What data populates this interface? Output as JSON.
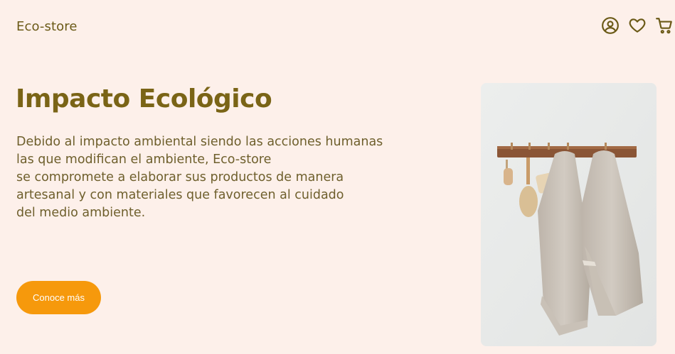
{
  "header": {
    "brand": "Eco-store",
    "icons": [
      "user-icon",
      "heart-icon",
      "cart-icon"
    ]
  },
  "hero": {
    "title": "Impacto Ecológico",
    "description_lines": [
      "Debido al impacto ambiental siendo las acciones humanas",
      "las que modifican el ambiente, Eco-store",
      "se compromete a elaborar sus productos de manera",
      "artesanal y con materiales que favorecen al cuidado",
      "del medio ambiente."
    ],
    "cta_label": "Conoce más"
  },
  "colors": {
    "background": "#fdf0ea",
    "brand_olive": "#7a6416",
    "accent_orange": "#f6990c"
  }
}
